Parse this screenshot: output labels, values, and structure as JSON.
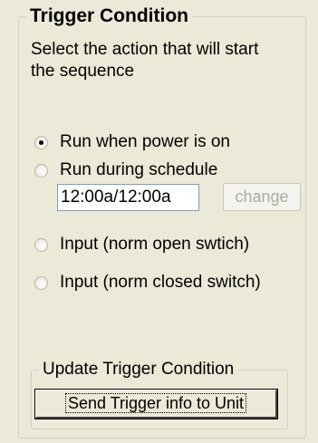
{
  "trigger_group": {
    "title": "Trigger Condition",
    "description": "Select the action that will start the sequence",
    "options": [
      {
        "label": "Run when power is on",
        "selected": true
      },
      {
        "label": "Run during schedule",
        "selected": false
      },
      {
        "label": "Input (norm open swtich)",
        "selected": false
      },
      {
        "label": "Input (norm closed switch)",
        "selected": false
      }
    ],
    "schedule": {
      "value": "12:00a/12:00a",
      "change_label": "change",
      "change_enabled": false
    }
  },
  "update_group": {
    "title": "Update Trigger Condition",
    "send_label": "Send Trigger info to Unit"
  }
}
